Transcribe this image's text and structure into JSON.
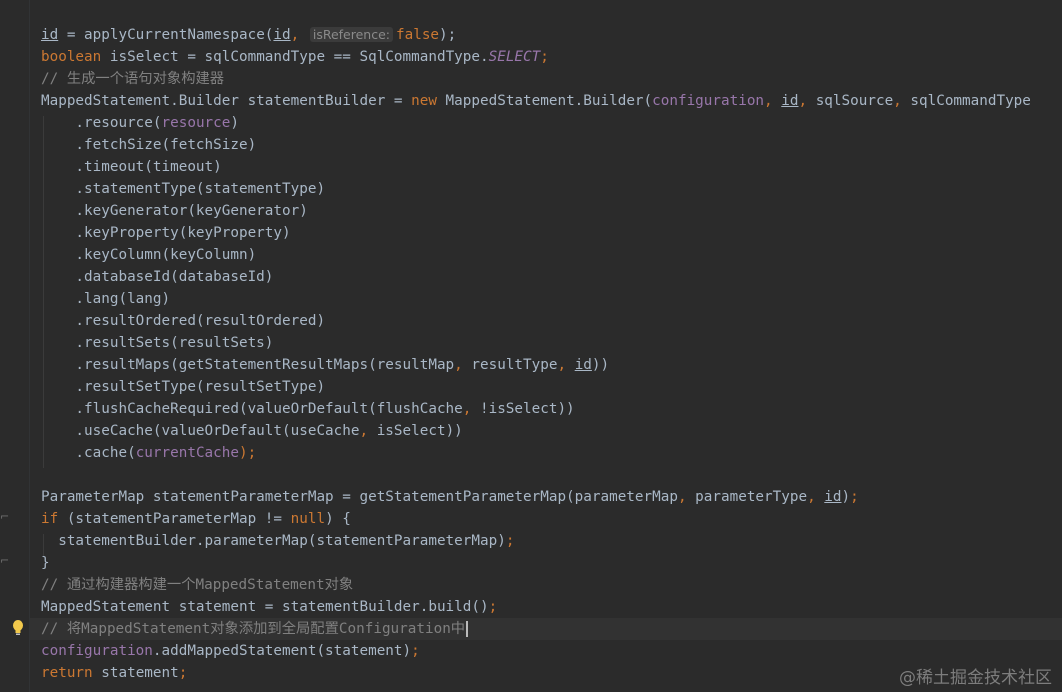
{
  "editor": {
    "param_hint": "isReference:",
    "lines": [
      {
        "parts": [
          [
            "u",
            "id"
          ],
          [
            "p",
            " = applyCurrentNamespace("
          ],
          [
            "u",
            "id"
          ],
          [
            "k",
            ", "
          ],
          [
            "hint",
            "isReference:"
          ],
          [
            "k",
            "false"
          ],
          [
            "p",
            ");"
          ]
        ]
      },
      {
        "parts": [
          [
            "k",
            "boolean"
          ],
          [
            "p",
            " isSelect = sqlCommandType == SqlCommandType."
          ],
          [
            "c",
            "SELECT"
          ],
          [
            "k",
            ";"
          ]
        ]
      },
      {
        "parts": [
          [
            "cm",
            "// 生成一个语句对象构建器"
          ]
        ]
      },
      {
        "parts": [
          [
            "p",
            "MappedStatement.Builder statementBuilder = "
          ],
          [
            "k",
            "new"
          ],
          [
            "p",
            " MappedStatement.Builder("
          ],
          [
            "f",
            "configuration"
          ],
          [
            "k",
            ", "
          ],
          [
            "u",
            "id"
          ],
          [
            "k",
            ", "
          ],
          [
            "p",
            "sqlSource"
          ],
          [
            "k",
            ", "
          ],
          [
            "p",
            "sqlCommandType"
          ]
        ]
      },
      {
        "parts": [
          [
            "p",
            "    .resource("
          ],
          [
            "f",
            "resource"
          ],
          [
            "p",
            ")"
          ]
        ]
      },
      {
        "parts": [
          [
            "p",
            "    .fetchSize(fetchSize)"
          ]
        ]
      },
      {
        "parts": [
          [
            "p",
            "    .timeout(timeout)"
          ]
        ]
      },
      {
        "parts": [
          [
            "p",
            "    .statementType(statementType)"
          ]
        ]
      },
      {
        "parts": [
          [
            "p",
            "    .keyGenerator(keyGenerator)"
          ]
        ]
      },
      {
        "parts": [
          [
            "p",
            "    .keyProperty(keyProperty)"
          ]
        ]
      },
      {
        "parts": [
          [
            "p",
            "    .keyColumn(keyColumn)"
          ]
        ]
      },
      {
        "parts": [
          [
            "p",
            "    .databaseId(databaseId)"
          ]
        ]
      },
      {
        "parts": [
          [
            "p",
            "    .lang(lang)"
          ]
        ]
      },
      {
        "parts": [
          [
            "p",
            "    .resultOrdered(resultOrdered)"
          ]
        ]
      },
      {
        "parts": [
          [
            "p",
            "    .resultSets(resultSets)"
          ]
        ]
      },
      {
        "parts": [
          [
            "p",
            "    .resultMaps(getStatementResultMaps(resultMap"
          ],
          [
            "k",
            ", "
          ],
          [
            "p",
            "resultType"
          ],
          [
            "k",
            ", "
          ],
          [
            "u",
            "id"
          ],
          [
            "p",
            "))"
          ]
        ]
      },
      {
        "parts": [
          [
            "p",
            "    .resultSetType(resultSetType)"
          ]
        ]
      },
      {
        "parts": [
          [
            "p",
            "    .flushCacheRequired(valueOrDefault(flushCache"
          ],
          [
            "k",
            ", "
          ],
          [
            "p",
            "!isSelect))"
          ]
        ]
      },
      {
        "parts": [
          [
            "p",
            "    .useCache(valueOrDefault(useCache"
          ],
          [
            "k",
            ", "
          ],
          [
            "p",
            "isSelect))"
          ]
        ]
      },
      {
        "parts": [
          [
            "p",
            "    .cache("
          ],
          [
            "f",
            "currentCache"
          ],
          [
            "k",
            ");"
          ]
        ]
      },
      {
        "parts": []
      },
      {
        "parts": [
          [
            "p",
            "ParameterMap statementParameterMap = getStatementParameterMap(parameterMap"
          ],
          [
            "k",
            ", "
          ],
          [
            "p",
            "parameterType"
          ],
          [
            "k",
            ", "
          ],
          [
            "u",
            "id"
          ],
          [
            "p",
            ")"
          ],
          [
            "k",
            ";"
          ]
        ]
      },
      {
        "parts": [
          [
            "k",
            "if"
          ],
          [
            "p",
            " (statementParameterMap != "
          ],
          [
            "k",
            "null"
          ],
          [
            "p",
            ") {"
          ]
        ]
      },
      {
        "parts": [
          [
            "p",
            "  statementBuilder.parameterMap(statementParameterMap)"
          ],
          [
            "k",
            ";"
          ]
        ]
      },
      {
        "parts": [
          [
            "p",
            "}"
          ]
        ]
      },
      {
        "parts": [
          [
            "cm",
            "// 通过构建器构建一个MappedStatement对象"
          ]
        ]
      },
      {
        "parts": [
          [
            "p",
            "MappedStatement statement = statementBuilder.build()"
          ],
          [
            "k",
            ";"
          ]
        ]
      },
      {
        "parts": [
          [
            "cm",
            "// 将MappedStatement对象添加到全局配置Configuration中"
          ],
          [
            "caret",
            ""
          ]
        ]
      },
      {
        "parts": [
          [
            "f",
            "configuration"
          ],
          [
            "p",
            ".addMappedStatement(statement)"
          ],
          [
            "k",
            ";"
          ]
        ]
      },
      {
        "parts": [
          [
            "k",
            "return"
          ],
          [
            "p",
            " statement"
          ],
          [
            "k",
            ";"
          ]
        ]
      }
    ]
  },
  "watermark": "@稀土掘金技术社区",
  "icons": {
    "bulb": "lightbulb-icon",
    "fold": "fold-marker-icon"
  }
}
